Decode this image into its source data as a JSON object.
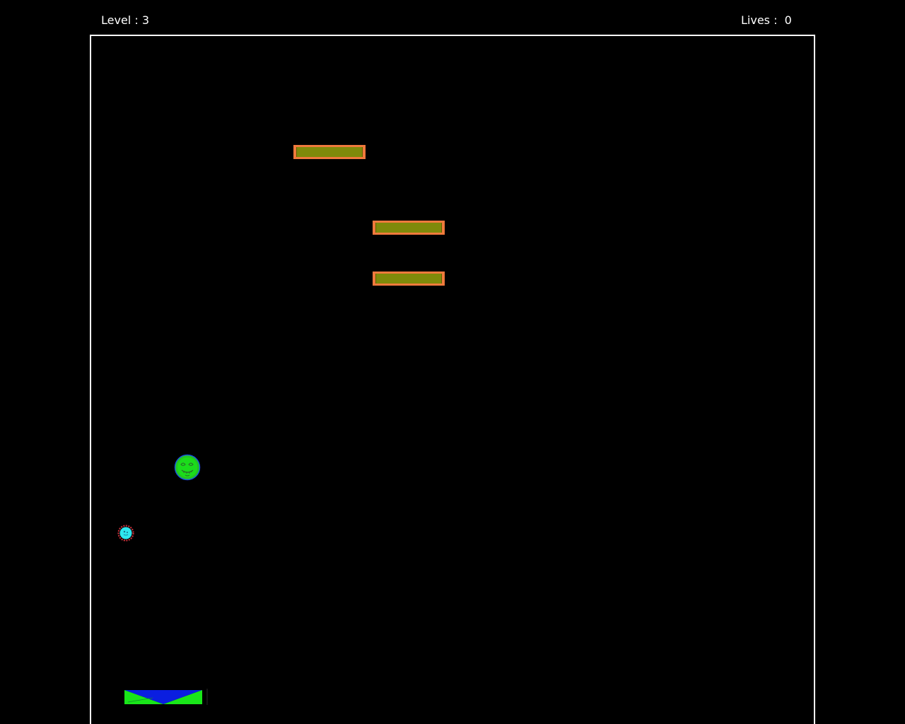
{
  "hud": {
    "level_label": "Level :",
    "level_value": "3",
    "lives_label": "Lives :",
    "lives_value": "0"
  },
  "colors": {
    "background": "#000000",
    "frame": "#ffffff",
    "brick_border": "#f07a3c",
    "brick_fill": "#7f8a0a",
    "face_ball": "#1bdc1b",
    "small_ball": "#2ee6ee",
    "paddle_blue": "#0a1ee0",
    "paddle_green": "#19e619"
  },
  "entities": {
    "bricks_count": 3,
    "player_ball_icon": "smiley-face-ball",
    "enemy_icon": "spiky-cyan-ball",
    "paddle_icon": "bowtie-paddle"
  }
}
